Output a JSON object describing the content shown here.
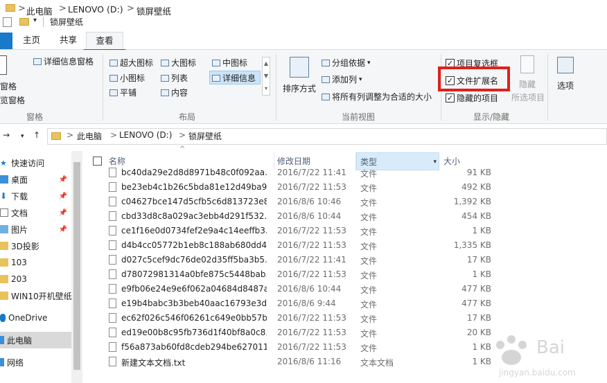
{
  "titlebar": {
    "crumb1": "此电脑",
    "crumb2": "LENOVO (D:)",
    "crumb3": "锁屏壁纸",
    "sep": ">"
  },
  "qat": {
    "title": "锁屏壁纸"
  },
  "tabs": {
    "home": "主页",
    "share": "共享",
    "view": "查看"
  },
  "ribbon": {
    "pane_group": {
      "label": "窗格",
      "details_pane": "详细信息窗格",
      "pane1": "窗格",
      "preview_pane": "览窗格"
    },
    "layout_group": {
      "label": "布局",
      "items": [
        "超大图标",
        "大图标",
        "中图标",
        "小图标",
        "列表",
        "详细信息",
        "平铺",
        "内容"
      ]
    },
    "current_view_group": {
      "label": "当前视图",
      "sort_by": "排序方式",
      "group_by": "分组依据",
      "add_column": "添加列",
      "fit_columns": "将所有列调整为合适的大小"
    },
    "show_hide_group": {
      "label": "显示/隐藏",
      "item_checkbox": "项目复选框",
      "file_ext": "文件扩展名",
      "hidden_items": "隐藏的项目",
      "hide": "隐藏",
      "selected_items": "所选项目"
    },
    "options": "选项"
  },
  "address": {
    "c1": "此电脑",
    "c2": "LENOVO (D:)",
    "c3": "锁屏壁纸",
    "sep": ">"
  },
  "nav": {
    "items": [
      {
        "label": "快速访问"
      },
      {
        "label": "桌面"
      },
      {
        "label": "下载"
      },
      {
        "label": "文档"
      },
      {
        "label": "图片"
      },
      {
        "label": "3D投影"
      },
      {
        "label": "103"
      },
      {
        "label": "203"
      },
      {
        "label": "WIN10开机壁纸"
      },
      {
        "label": "OneDrive"
      },
      {
        "label": "此电脑"
      },
      {
        "label": "网络"
      }
    ]
  },
  "columns": {
    "name": "名称",
    "date": "修改日期",
    "type": "类型",
    "size": "大小"
  },
  "files": [
    {
      "name": "bc40da29e2d8d8971b48c0f092aa...",
      "date": "2016/7/22 11:41",
      "type": "文件",
      "size": "91 KB"
    },
    {
      "name": "be23eb4c1b26c5bda81e12d49ba9...",
      "date": "2016/7/22 11:53",
      "type": "文件",
      "size": "492 KB"
    },
    {
      "name": "c04627bce147d5cfb5c6d813723e8...",
      "date": "2016/8/6 10:46",
      "type": "文件",
      "size": "1,392 KB"
    },
    {
      "name": "cbd33d8c8a029ac3ebb4d291f532...",
      "date": "2016/8/6 10:44",
      "type": "文件",
      "size": "454 KB"
    },
    {
      "name": "ce1f16e0d0734fef2e9a4c14eeffb3...",
      "date": "2016/7/22 11:53",
      "type": "文件",
      "size": "1 KB"
    },
    {
      "name": "d4b4cc05772b1eb8c188ab680dd4...",
      "date": "2016/7/22 11:53",
      "type": "文件",
      "size": "1,335 KB"
    },
    {
      "name": "d027c5cef9dc76de02d35ff5ba3b5...",
      "date": "2016/7/22 11:41",
      "type": "文件",
      "size": "17 KB"
    },
    {
      "name": "d78072981314a0bfe875c5448bab...",
      "date": "2016/7/22 11:53",
      "type": "文件",
      "size": "1 KB"
    },
    {
      "name": "e9fb06e24e9e6f062a04684d8487a...",
      "date": "2016/8/6 10:44",
      "type": "文件",
      "size": "477 KB"
    },
    {
      "name": "e19b4babc3b3beb40aac16793e3d...",
      "date": "2016/8/6 9:44",
      "type": "文件",
      "size": "477 KB"
    },
    {
      "name": "ec62f026c546f06261c649e0bb57b...",
      "date": "2016/7/22 11:53",
      "type": "文件",
      "size": "17 KB"
    },
    {
      "name": "ed19e00b8c95fb736d1f40bf8a0c8...",
      "date": "2016/7/22 11:53",
      "type": "文件",
      "size": "20 KB"
    },
    {
      "name": "f56a873ab60fd8cdeb294be627011...",
      "date": "2016/7/22 11:53",
      "type": "文件",
      "size": "1 KB"
    },
    {
      "name": "新建文本文档.txt",
      "date": "2016/8/6 11:16",
      "type": "文本文档",
      "size": "1 KB"
    }
  ],
  "colors": {
    "accent": "#1979ca",
    "highlight_red": "#e0201c",
    "header_selected": "#d9ebf9"
  }
}
